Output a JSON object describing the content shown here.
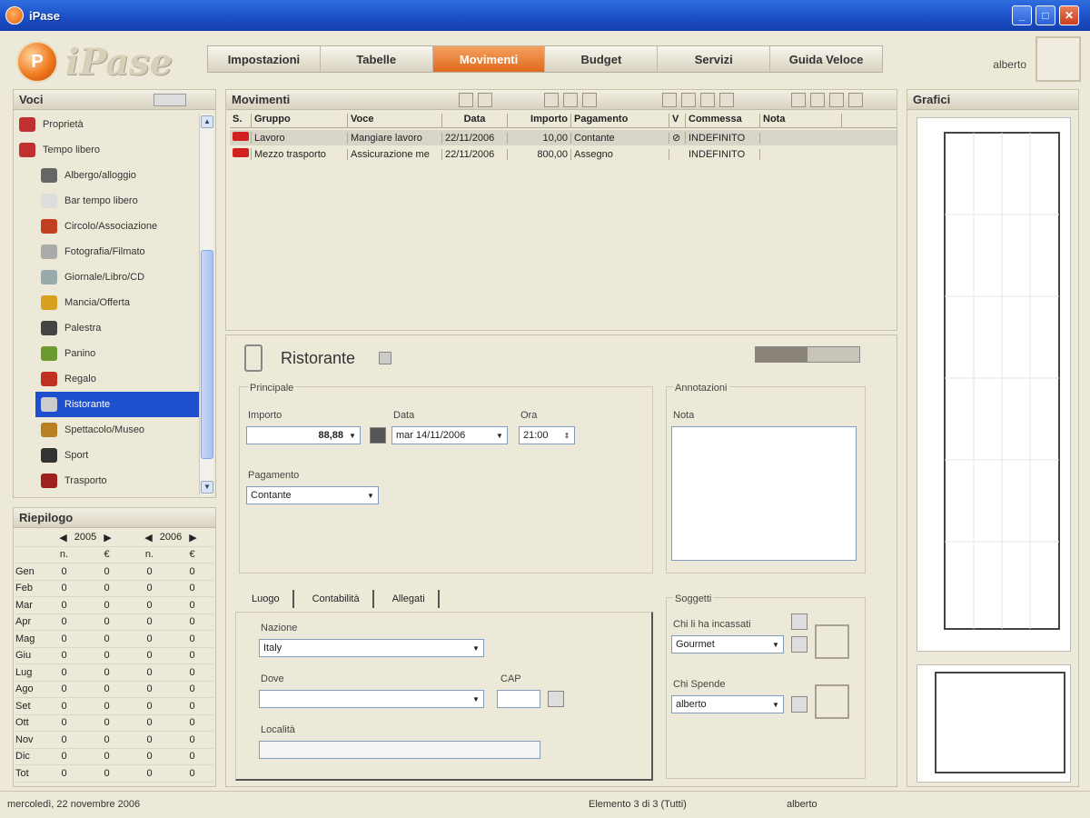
{
  "window": {
    "title": "iPase",
    "minimize": "_",
    "maximize": "□",
    "close": "✕"
  },
  "logo": {
    "letter": "P",
    "word": "iPase"
  },
  "nav": {
    "tabs": [
      "Impostazioni",
      "Tabelle",
      "Movimenti",
      "Budget",
      "Servizi",
      "Guida Veloce"
    ],
    "active": "Movimenti"
  },
  "user": "alberto",
  "voci": {
    "title": "Voci",
    "items": [
      {
        "label": "Proprietà",
        "indent": false,
        "icon": "folder-red-icon"
      },
      {
        "label": "Tempo libero",
        "indent": false,
        "icon": "folder-red-icon"
      },
      {
        "label": "Albergo/alloggio",
        "indent": true,
        "icon": "hotel-icon"
      },
      {
        "label": "Bar tempo libero",
        "indent": true,
        "icon": "bar-icon"
      },
      {
        "label": "Circolo/Associazione",
        "indent": true,
        "icon": "cross-icon"
      },
      {
        "label": "Fotografia/Filmato",
        "indent": true,
        "icon": "camera-icon"
      },
      {
        "label": "Giornale/Libro/CD",
        "indent": true,
        "icon": "book-icon"
      },
      {
        "label": "Mancia/Offerta",
        "indent": true,
        "icon": "tip-icon"
      },
      {
        "label": "Palestra",
        "indent": true,
        "icon": "gym-icon"
      },
      {
        "label": "Panino",
        "indent": true,
        "icon": "sandwich-icon"
      },
      {
        "label": "Regalo",
        "indent": true,
        "icon": "gift-icon"
      },
      {
        "label": "Ristorante",
        "indent": true,
        "icon": "fork-icon",
        "selected": true
      },
      {
        "label": "Spettacolo/Museo",
        "indent": true,
        "icon": "theater-icon"
      },
      {
        "label": "Sport",
        "indent": true,
        "icon": "ball-icon"
      },
      {
        "label": "Trasporto",
        "indent": true,
        "icon": "transport-icon"
      }
    ]
  },
  "riepilogo": {
    "title": "Riepilogo",
    "year1": "2005",
    "year2": "2006",
    "col_n": "n.",
    "col_eur": "€",
    "rows": [
      [
        "Gen",
        "0",
        "0",
        "0",
        "0"
      ],
      [
        "Feb",
        "0",
        "0",
        "0",
        "0"
      ],
      [
        "Mar",
        "0",
        "0",
        "0",
        "0"
      ],
      [
        "Apr",
        "0",
        "0",
        "0",
        "0"
      ],
      [
        "Mag",
        "0",
        "0",
        "0",
        "0"
      ],
      [
        "Giu",
        "0",
        "0",
        "0",
        "0"
      ],
      [
        "Lug",
        "0",
        "0",
        "0",
        "0"
      ],
      [
        "Ago",
        "0",
        "0",
        "0",
        "0"
      ],
      [
        "Set",
        "0",
        "0",
        "0",
        "0"
      ],
      [
        "Ott",
        "0",
        "0",
        "0",
        "0"
      ],
      [
        "Nov",
        "0",
        "0",
        "0",
        "0"
      ],
      [
        "Dic",
        "0",
        "0",
        "0",
        "0"
      ],
      [
        "Tot",
        "0",
        "0",
        "0",
        "0"
      ]
    ]
  },
  "movimenti": {
    "title": "Movimenti",
    "headers": [
      "S.",
      "Gruppo",
      "Voce",
      "Data",
      "Importo",
      "Pagamento",
      "V",
      "Commessa",
      "Nota"
    ],
    "rows": [
      [
        "",
        "Lavoro",
        "Mangiare lavoro",
        "22/11/2006",
        "10,00",
        "Contante",
        "⊘",
        "INDEFINITO",
        ""
      ],
      [
        "",
        "Mezzo trasporto",
        "Assicurazione me",
        "22/11/2006",
        "800,00",
        "Assegno",
        "",
        "INDEFINITO",
        ""
      ]
    ]
  },
  "detail": {
    "title": "Ristorante",
    "principale": "Principale",
    "importo_label": "Importo",
    "importo": "88,88",
    "data_label": "Data",
    "data": "mar 14/11/2006",
    "ora_label": "Ora",
    "ora": "21:00",
    "pagamento_label": "Pagamento",
    "pagamento": "Contante",
    "annotazioni": "Annotazioni",
    "nota_label": "Nota",
    "tabs": [
      "Luogo",
      "Contabilità",
      "Allegati"
    ],
    "nazione_label": "Nazione",
    "nazione": "Italy",
    "dove_label": "Dove",
    "cap_label": "CAP",
    "localita_label": "Località",
    "soggetti": "Soggetti",
    "chi_incassato_label": "Chi li ha incassati",
    "chi_incassato": "Gourmet",
    "chi_spende_label": "Chi Spende",
    "chi_spende": "alberto"
  },
  "grafici": {
    "title": "Grafici"
  },
  "status": {
    "date": "mercoledì, 22 novembre 2006",
    "element": "Elemento 3 di 3 (Tutti)",
    "user": "alberto"
  }
}
